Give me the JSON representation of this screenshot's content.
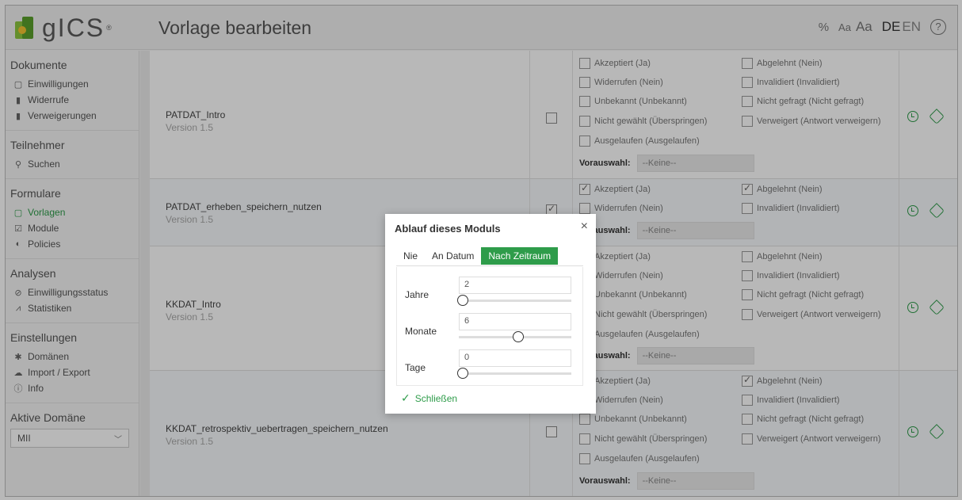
{
  "app": {
    "logo_text": "gICS",
    "logo_reg": "®",
    "page_title": "Vorlage bearbeiten"
  },
  "header": {
    "pct_icon": "%",
    "font_small": "Aa",
    "font_big": "Aa",
    "lang_de": "DE",
    "lang_en": "EN",
    "help": "?"
  },
  "sidebar": {
    "sections": [
      {
        "title": "Dokumente",
        "items": [
          "Einwilligungen",
          "Widerrufe",
          "Verweigerungen"
        ]
      },
      {
        "title": "Teilnehmer",
        "items": [
          "Suchen"
        ]
      },
      {
        "title": "Formulare",
        "items": [
          "Vorlagen",
          "Module",
          "Policies"
        ]
      },
      {
        "title": "Analysen",
        "items": [
          "Einwilligungsstatus",
          "Statistiken"
        ]
      },
      {
        "title": "Einstellungen",
        "items": [
          "Domänen",
          "Import / Export",
          "Info"
        ]
      }
    ],
    "active_domain_title": "Aktive Domäne",
    "active_domain_value": "MII"
  },
  "rows": [
    {
      "name": "PATDAT_Intro",
      "version": "Version 1.5",
      "options": {
        "akzeptiert": "Akzeptiert (Ja)",
        "abgelehnt": "Abgelehnt (Nein)",
        "widerrufen": "Widerrufen (Nein)",
        "invalidiert": "Invalidiert (Invalidiert)",
        "unbekannt": "Unbekannt (Unbekannt)",
        "nicht_gefragt": "Nicht gefragt (Nicht gefragt)",
        "nicht_gewaehlt": "Nicht gewählt (Überspringen)",
        "verweigert": "Verweigert (Antwort verweigern)",
        "ausgelaufen": "Ausgelaufen (Ausgelaufen)"
      },
      "vorauswahl_label": "Vorauswahl:",
      "vorauswahl_value": "--Keine--"
    },
    {
      "name": "PATDAT_erheben_speichern_nutzen",
      "version": "Version 1.5",
      "options": {
        "akzeptiert": "Akzeptiert (Ja)",
        "abgelehnt": "Abgelehnt (Nein)",
        "widerrufen": "Widerrufen (Nein)",
        "invalidiert": "Invalidiert (Invalidiert)"
      },
      "vorauswahl_label": "Vorauswahl:",
      "vorauswahl_value": "--Keine--"
    },
    {
      "name": "KKDAT_Intro",
      "version": "Version 1.5",
      "options": {
        "akzeptiert": "Akzeptiert (Ja)",
        "abgelehnt": "Abgelehnt (Nein)",
        "widerrufen": "Widerrufen (Nein)",
        "invalidiert": "Invalidiert (Invalidiert)",
        "unbekannt": "Unbekannt (Unbekannt)",
        "nicht_gefragt": "Nicht gefragt (Nicht gefragt)",
        "nicht_gewaehlt": "Nicht gewählt (Überspringen)",
        "verweigert": "Verweigert (Antwort verweigern)",
        "ausgelaufen": "Ausgelaufen (Ausgelaufen)"
      },
      "vorauswahl_label": "Vorauswahl:",
      "vorauswahl_value": "--Keine--"
    },
    {
      "name": "KKDAT_retrospektiv_uebertragen_speichern_nutzen",
      "version": "Version 1.5",
      "options": {
        "akzeptiert": "Akzeptiert (Ja)",
        "abgelehnt": "Abgelehnt (Nein)",
        "widerrufen": "Widerrufen (Nein)",
        "invalidiert": "Invalidiert (Invalidiert)",
        "unbekannt": "Unbekannt (Unbekannt)",
        "nicht_gefragt": "Nicht gefragt (Nicht gefragt)",
        "nicht_gewaehlt": "Nicht gewählt (Überspringen)",
        "verweigert": "Verweigert (Antwort verweigern)",
        "ausgelaufen": "Ausgelaufen (Ausgelaufen)"
      },
      "vorauswahl_label": "Vorauswahl:",
      "vorauswahl_value": "--Keine--"
    }
  ],
  "modal": {
    "title": "Ablauf dieses Moduls",
    "close": "×",
    "tabs": [
      "Nie",
      "An Datum",
      "Nach Zeitraum"
    ],
    "active_tab": "Nach Zeitraum",
    "fields": [
      {
        "label": "Jahre",
        "value": "2",
        "slider_fraction": 0.0
      },
      {
        "label": "Monate",
        "value": "6",
        "slider_fraction": 0.55
      },
      {
        "label": "Tage",
        "value": "0",
        "slider_fraction": 0.0
      }
    ],
    "close_button": "Schließen"
  },
  "colors": {
    "accent": "#2e9c4a",
    "overlay": "rgba(0,0,0,0.28)"
  }
}
